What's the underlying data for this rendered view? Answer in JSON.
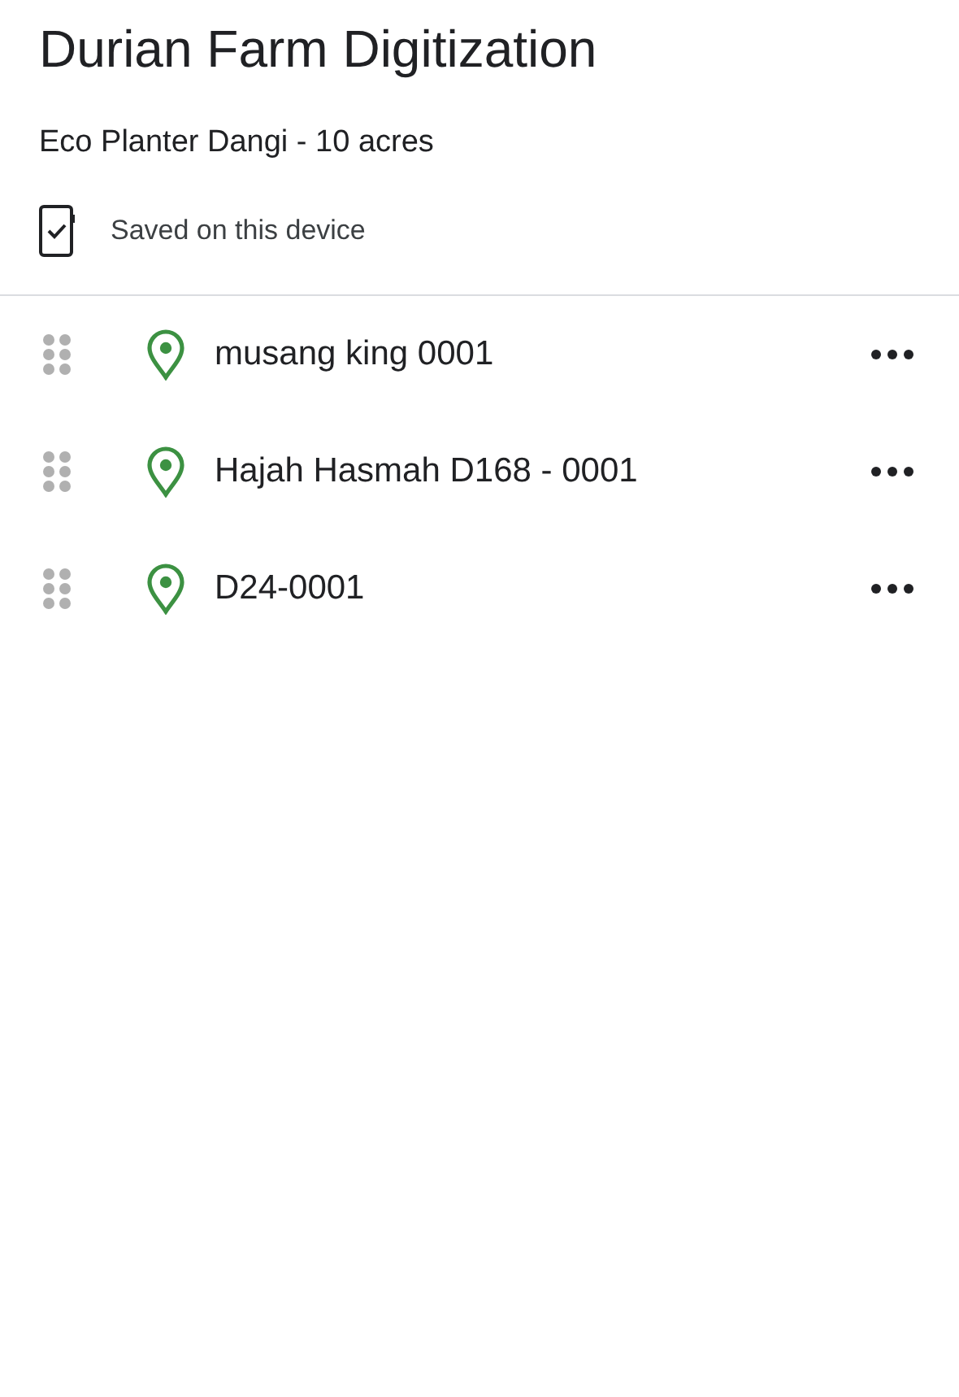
{
  "title": "Durian Farm Digitization",
  "subtitle": "Eco Planter Dangi - 10 acres",
  "status": {
    "label": "Saved on this device"
  },
  "items": [
    {
      "name": "musang king 0001"
    },
    {
      "name": "Hajah Hasmah D168 - 0001"
    },
    {
      "name": "D24-0001"
    }
  ]
}
